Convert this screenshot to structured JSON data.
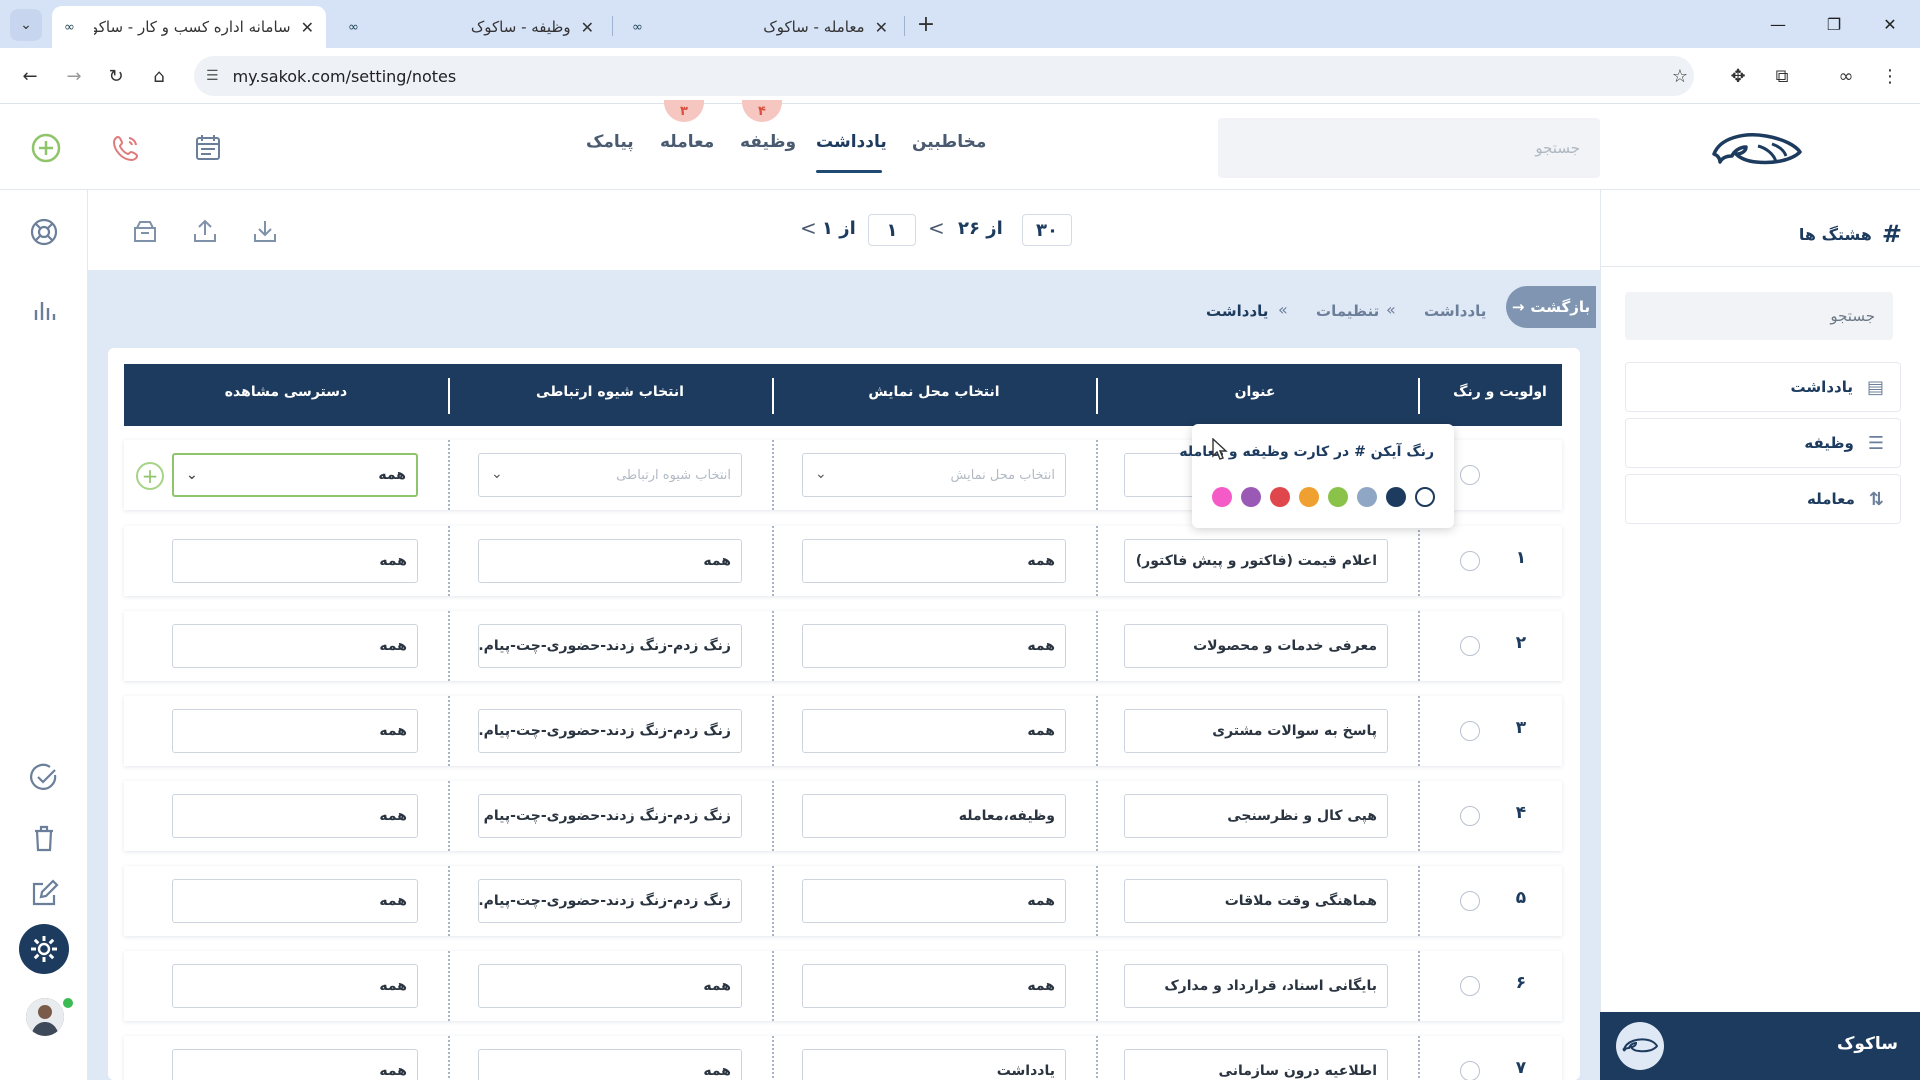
{
  "browser": {
    "tabs": [
      {
        "title": "سامانه اداره کسب و کار - ساکوک",
        "active": true
      },
      {
        "title": "وظیفه - ساکوک",
        "active": false
      },
      {
        "title": "معامله - ساکوک",
        "active": false
      }
    ],
    "url": "my.sakok.com/setting/notes"
  },
  "header": {
    "nav": [
      {
        "label": "مخاطبین",
        "badge": ""
      },
      {
        "label": "یادداشت",
        "badge": "",
        "active": true
      },
      {
        "label": "وظیفه",
        "badge": "۴"
      },
      {
        "label": "معامله",
        "badge": "۳"
      },
      {
        "label": "پیامک",
        "badge": ""
      }
    ],
    "search_placeholder": "جستجو"
  },
  "toolbar": {
    "per_page": "۳۰",
    "of_label": "از",
    "total": "۲۶",
    "page": "۱",
    "pages_of_label": "از",
    "total_pages": "۱"
  },
  "breadcrumb": {
    "back_label": "بازگشت",
    "items": [
      "یادداشت",
      "تنظیمات",
      "یادداشت"
    ]
  },
  "table": {
    "headers": [
      "اولویت و رنگ",
      "عنوان",
      "انتخاب محل نمایش",
      "انتخاب شیوه ارتباطی",
      "دسترسی مشاهده"
    ],
    "new_row": {
      "display_placeholder": "انتخاب محل نمایش",
      "method_placeholder": "انتخاب شیوه ارتباطی",
      "access_value": "همه"
    },
    "rows": [
      {
        "num": "۱",
        "title": "اعلام قیمت (فاکتور و پیش فاکتور)",
        "display": "همه",
        "method": "همه",
        "access": "همه"
      },
      {
        "num": "۲",
        "title": "معرفی خدمات و محصولات",
        "display": "همه",
        "method": "زنگ زدم-زنگ زدند-حضوری-چت-پیام...",
        "access": "همه"
      },
      {
        "num": "۳",
        "title": "پاسخ به سوالات مشتری",
        "display": "همه",
        "method": "زنگ زدم-زنگ زدند-حضوری-چت-پیام...",
        "access": "همه"
      },
      {
        "num": "۴",
        "title": "هپی کال و نظرسنجی",
        "display": "وظیفه،معامله",
        "method": "زنگ زدم-زنگ زدند-حضوری-چت-پیام",
        "access": "همه"
      },
      {
        "num": "۵",
        "title": "هماهنگی وقت ملاقات",
        "display": "همه",
        "method": "زنگ زدم-زنگ زدند-حضوری-چت-پیام...",
        "access": "همه"
      },
      {
        "num": "۶",
        "title": "بایگانی اسناد، قرارداد و مدارک",
        "display": "همه",
        "method": "همه",
        "access": "همه"
      },
      {
        "num": "۷",
        "title": "اطلاعیه درون سازمانی",
        "display": "یادداشت",
        "method": "همه",
        "access": "همه"
      }
    ]
  },
  "popover": {
    "text": "رنگ آیکن # در کارت وظیفه و معامله",
    "swatches": [
      "#f45bc7",
      "#9b59b6",
      "#e0474c",
      "#f0a030",
      "#8bc34a",
      "#8fa7c4",
      "#1d3b5e",
      "empty"
    ]
  },
  "sidebar": {
    "title": "هشتگ ها",
    "search_placeholder": "جستجو",
    "items": [
      {
        "label": "یادداشت",
        "icon": "notes-icon"
      },
      {
        "label": "وظیفه",
        "icon": "list-icon"
      },
      {
        "label": "معامله",
        "icon": "deal-icon"
      }
    ],
    "footer_name": "ساکوک"
  },
  "colors": {
    "brand": "#1d3b5e",
    "accent_green": "#8fc56a",
    "badge_red": "#d9503f"
  }
}
